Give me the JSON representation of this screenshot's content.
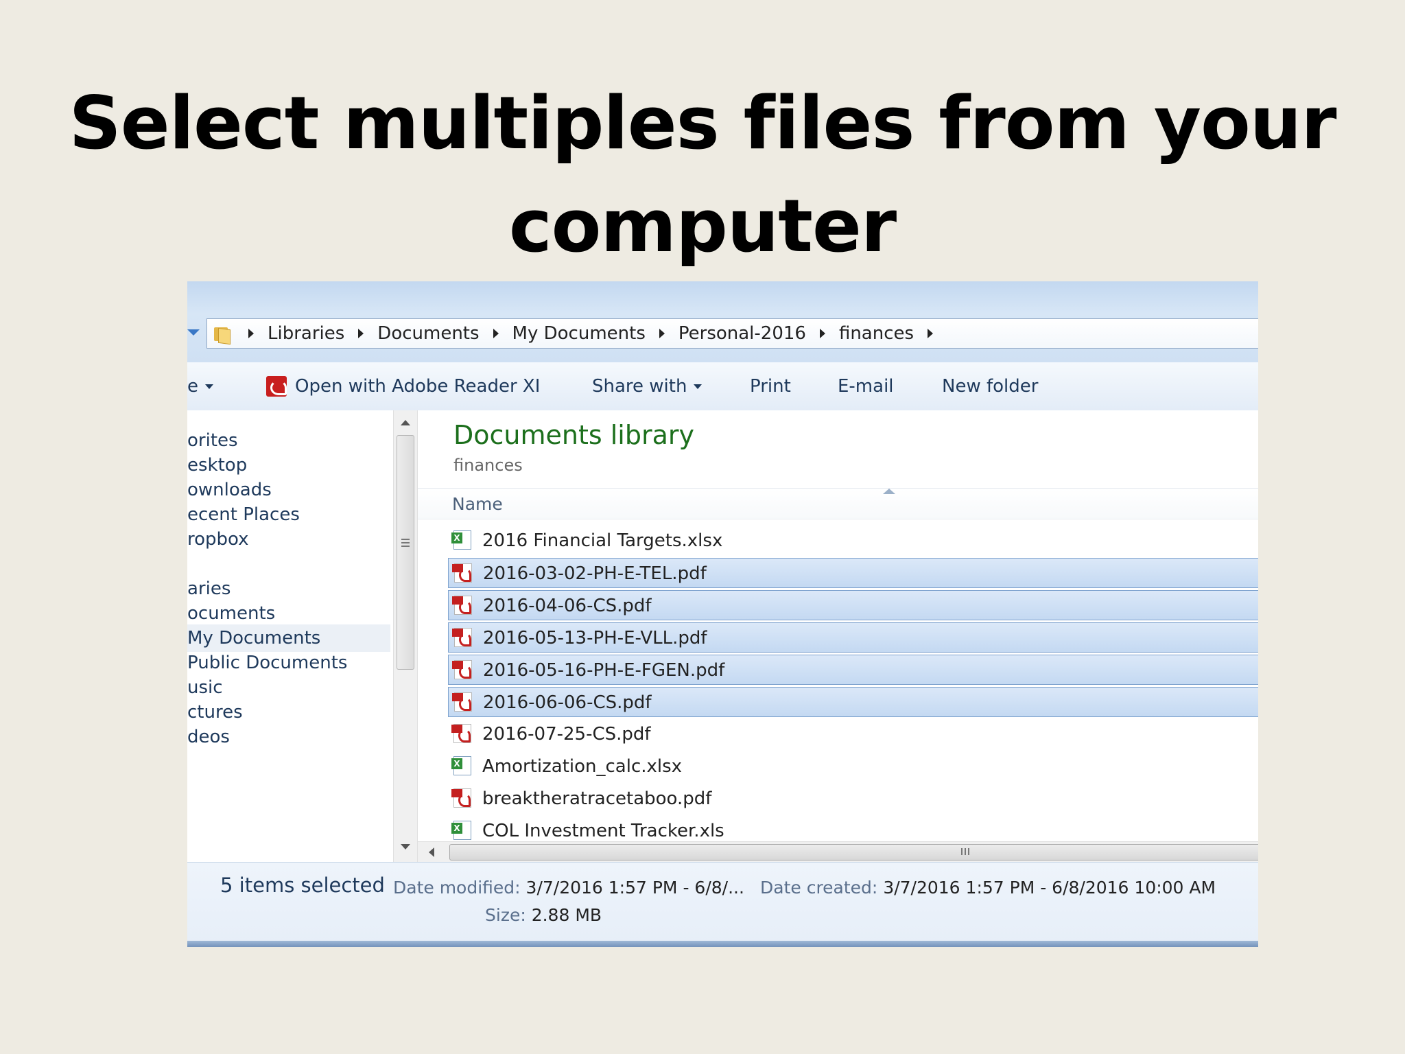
{
  "slide_title": {
    "line1": "Select multiples files from your",
    "line2": "computer"
  },
  "breadcrumb": [
    "Libraries",
    "Documents",
    "My Documents",
    "Personal-2016",
    "finances"
  ],
  "toolbar": {
    "organize_label": "e",
    "open_with_label": "Open with Adobe Reader XI",
    "share_with_label": "Share with",
    "print_label": "Print",
    "email_label": "E-mail",
    "new_folder_label": "New folder"
  },
  "nav_pane": {
    "items": [
      "orites",
      "esktop",
      "ownloads",
      "ecent Places",
      "ropbox",
      "aries",
      "ocuments",
      "My Documents",
      "Public Documents",
      "usic",
      "ctures",
      "deos"
    ],
    "selected": "My Documents"
  },
  "library": {
    "title": "Documents library",
    "subtitle": "finances",
    "column_name": "Name"
  },
  "files": [
    {
      "name": "2016 Financial Targets.xlsx",
      "type": "xlsx",
      "selected": false
    },
    {
      "name": "2016-03-02-PH-E-TEL.pdf",
      "type": "pdf",
      "selected": true
    },
    {
      "name": "2016-04-06-CS.pdf",
      "type": "pdf",
      "selected": true
    },
    {
      "name": "2016-05-13-PH-E-VLL.pdf",
      "type": "pdf",
      "selected": true
    },
    {
      "name": "2016-05-16-PH-E-FGEN.pdf",
      "type": "pdf",
      "selected": true
    },
    {
      "name": "2016-06-06-CS.pdf",
      "type": "pdf",
      "selected": true
    },
    {
      "name": "2016-07-25-CS.pdf",
      "type": "pdf",
      "selected": false
    },
    {
      "name": "Amortization_calc.xlsx",
      "type": "xlsx",
      "selected": false
    },
    {
      "name": "breaktheratracetaboo.pdf",
      "type": "pdf",
      "selected": false
    },
    {
      "name": "COL Investment Tracker.xls",
      "type": "xlsx",
      "selected": false
    }
  ],
  "details": {
    "selection_count": "5 items selected",
    "date_modified_label": "Date modified:",
    "date_modified_value": "3/7/2016 1:57 PM - 6/8/...",
    "date_created_label": "Date created:",
    "date_created_value": "3/7/2016 1:57 PM - 6/8/2016 10:00 AM",
    "size_label": "Size:",
    "size_value": "2.88 MB"
  },
  "colors": {
    "background": "#eeebe2",
    "selection": "#c4d9f2",
    "library_title": "#1c6f1c",
    "pdf_red": "#c41f1f",
    "excel_green": "#2f8f3a"
  }
}
